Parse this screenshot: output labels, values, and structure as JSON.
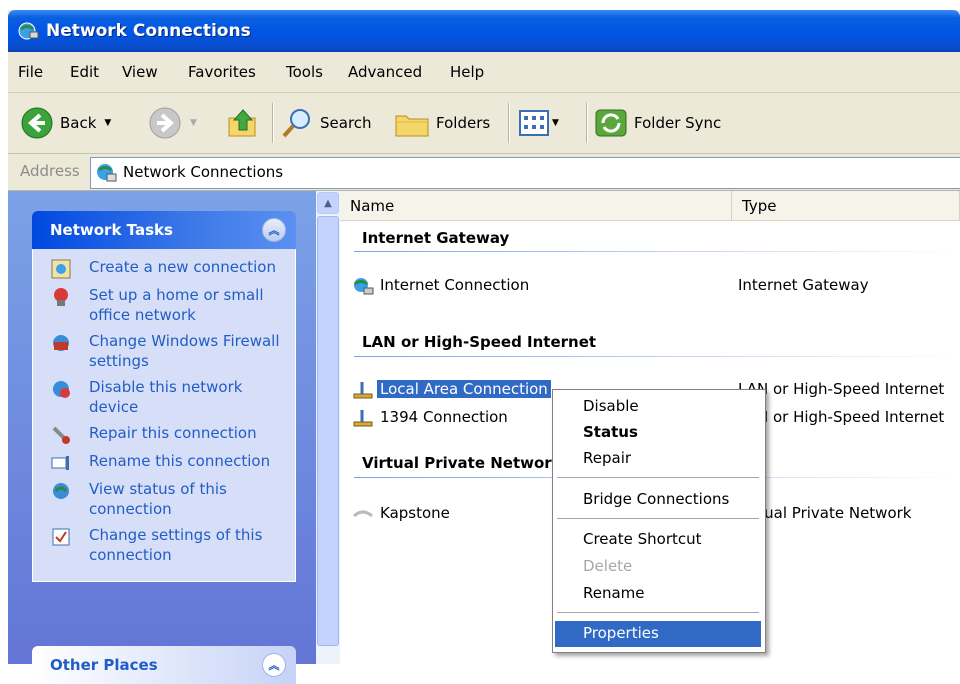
{
  "window": {
    "title": "Network Connections"
  },
  "menu": [
    "File",
    "Edit",
    "View",
    "Favorites",
    "Tools",
    "Advanced",
    "Help"
  ],
  "toolbar": {
    "back": "Back",
    "search": "Search",
    "folders": "Folders",
    "folder_sync": "Folder Sync"
  },
  "address": {
    "label": "Address",
    "value": "Network Connections"
  },
  "tasks_panel": {
    "title": "Network Tasks",
    "items": [
      {
        "label": "Create a new connection",
        "icon": "new-connection-icon"
      },
      {
        "label": "Set up a home or small office network",
        "icon": "home-network-icon"
      },
      {
        "label": "Change Windows Firewall settings",
        "icon": "firewall-icon"
      },
      {
        "label": "Disable this network device",
        "icon": "disable-network-icon"
      },
      {
        "label": "Repair this connection",
        "icon": "repair-icon"
      },
      {
        "label": "Rename this connection",
        "icon": "rename-icon"
      },
      {
        "label": "View status of this connection",
        "icon": "status-icon"
      },
      {
        "label": "Change settings of this connection",
        "icon": "settings-icon"
      }
    ]
  },
  "places_panel": {
    "title": "Other Places"
  },
  "columns": {
    "name": "Name",
    "type": "Type"
  },
  "groups": {
    "internet_gateway": "Internet Gateway",
    "lan": "LAN or High-Speed Internet",
    "vpn": "Virtual Private Network"
  },
  "connections": {
    "internet": {
      "name": "Internet Connection",
      "type": "Internet Gateway"
    },
    "local": {
      "name": "Local Area Connection",
      "type": "LAN or High-Speed Internet"
    },
    "c1394": {
      "name": "1394 Connection",
      "type": "LAN or High-Speed Internet"
    },
    "kapstone": {
      "name": "Kapstone",
      "type": "Virtual Private Network"
    }
  },
  "context_menu": {
    "disable": "Disable",
    "status": "Status",
    "repair": "Repair",
    "bridge": "Bridge Connections",
    "shortcut": "Create Shortcut",
    "delete": "Delete",
    "rename": "Rename",
    "properties": "Properties"
  },
  "colors": {
    "title_bar": "#0055e5",
    "task_link": "#215dc6",
    "selection": "#316ac5"
  }
}
